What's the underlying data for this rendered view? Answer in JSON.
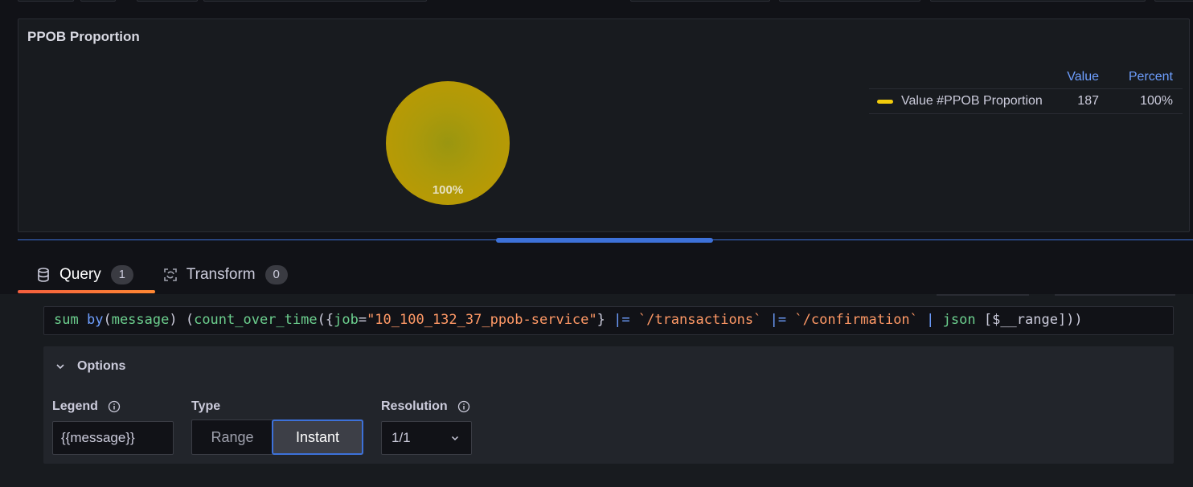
{
  "panel": {
    "title": "PPOB Proportion",
    "pie_label": "100%",
    "legend": {
      "headers": {
        "value": "Value",
        "percent": "Percent"
      },
      "rows": [
        {
          "name": "Value #PPOB Proportion",
          "value": "187",
          "percent": "100%",
          "color": "#f2cc0c"
        }
      ]
    }
  },
  "tabs": [
    {
      "label": "Query",
      "count": "1",
      "icon": "database-icon",
      "active": true
    },
    {
      "label": "Transform",
      "count": "0",
      "icon": "transform-icon",
      "active": false
    }
  ],
  "query": {
    "parts": [
      {
        "t": "sum",
        "c": "q-fn"
      },
      {
        "t": " ",
        "c": "q-op"
      },
      {
        "t": "by",
        "c": "q-kw"
      },
      {
        "t": "(",
        "c": "q-op"
      },
      {
        "t": "message",
        "c": "q-label"
      },
      {
        "t": ") (",
        "c": "q-op"
      },
      {
        "t": "count_over_time",
        "c": "q-fn"
      },
      {
        "t": "({",
        "c": "q-op"
      },
      {
        "t": "job",
        "c": "q-label"
      },
      {
        "t": "=",
        "c": "q-op"
      },
      {
        "t": "\"10_100_132_37_ppob-service\"",
        "c": "q-str"
      },
      {
        "t": "} ",
        "c": "q-op"
      },
      {
        "t": "|=",
        "c": "q-kw"
      },
      {
        "t": " ",
        "c": "q-op"
      },
      {
        "t": "`/transactions`",
        "c": "q-str"
      },
      {
        "t": " ",
        "c": "q-op"
      },
      {
        "t": "|=",
        "c": "q-kw"
      },
      {
        "t": " ",
        "c": "q-op"
      },
      {
        "t": "`/confirmation`",
        "c": "q-str"
      },
      {
        "t": " ",
        "c": "q-op"
      },
      {
        "t": "|",
        "c": "q-kw"
      },
      {
        "t": " ",
        "c": "q-op"
      },
      {
        "t": "json",
        "c": "q-fn"
      },
      {
        "t": " [$__range]))",
        "c": "q-op"
      }
    ]
  },
  "options": {
    "title": "Options",
    "legend_label": "Legend",
    "legend_value": "{{message}}",
    "type_label": "Type",
    "type_options": [
      "Range",
      "Instant"
    ],
    "type_selected": "Instant",
    "resolution_label": "Resolution",
    "resolution_value": "1/1"
  }
}
